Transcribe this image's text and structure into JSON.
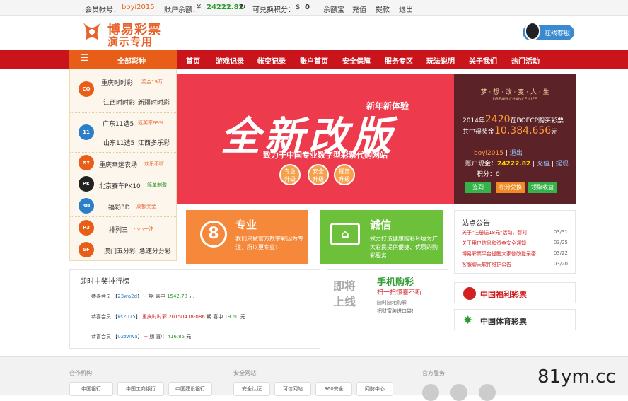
{
  "topbar": {
    "member_label": "会员帐号：",
    "member_name": "boyi2015",
    "balance_label": "账户余额：",
    "currency": "¥",
    "balance": "24222.82",
    "refresh_icon": "refresh-icon",
    "points_label": "可兑换积分：",
    "points_currency": "$",
    "points": "0",
    "links": [
      "余额宝",
      "充值",
      "提款",
      "退出"
    ]
  },
  "header": {
    "logo_line1": "博易彩票",
    "logo_line2": "演示专用",
    "online_service": "在线客服"
  },
  "nav": {
    "all_label": "全部彩种",
    "menu_icon": "menu-icon",
    "items": [
      "首页",
      "游戏记录",
      "帐变记录",
      "账户首页",
      "安全保障",
      "服务专区",
      "玩法说明",
      "关于我们",
      "热门活动"
    ]
  },
  "sidebar": {
    "rows": [
      {
        "icon": "CQ",
        "color": "#e85d17",
        "name1": "重庆时时彩",
        "badge": "奖金19万",
        "name2": "江西时时彩",
        "name3": "新疆时时彩"
      },
      {
        "icon": "11",
        "color": "#2b7fc8",
        "name1": "广东11选5",
        "badge": "返奖率69%",
        "name2": "山东11选5",
        "name3": "江西多乐彩"
      },
      {
        "icon": "XY",
        "color": "#e85d17",
        "name1": "重庆幸运农场",
        "badge": "欢乐不断"
      },
      {
        "icon": "PK",
        "color": "#222222",
        "name1": "北京赛车PK10",
        "badge": "简单刺激"
      },
      {
        "icon": "3D",
        "color": "#2b7fc8",
        "name1": "福彩3D",
        "badge": "高额奖金"
      },
      {
        "icon": "P3",
        "color": "#e85d17",
        "name1": "排列三",
        "badge": "小小一注"
      },
      {
        "icon": "5F",
        "color": "#e85d17",
        "name1": "澳门五分彩",
        "name3": "急速分分彩"
      }
    ]
  },
  "banner": {
    "small": "新年新体验",
    "headline": "全新改版",
    "subtitle": "致力于中国专业数字型彩票代购网站",
    "pills": [
      [
        "专业",
        "升级"
      ],
      [
        "安全",
        "升级"
      ],
      [
        "视觉",
        "升级"
      ]
    ]
  },
  "userpanel": {
    "slogan": "梦 · 想 · 改 · 变 · 人 · 生",
    "slogan_en": "DREAM CHANCE LIFE",
    "line1_pre": "2014年",
    "line1_num": "2420",
    "line1_post": "在BOECP购买彩票",
    "line2_pre": "共中得奖金",
    "line2_num": "10,384,656",
    "line2_post": "元",
    "username": "boyi2015",
    "sep": "|",
    "logout": "退出",
    "cash_label": "账户现金：",
    "cash": "24222.82",
    "recharge": "充值",
    "withdraw": "提现",
    "points_label": "积分：",
    "points": "0",
    "buttons": [
      "签到",
      "积分兑换",
      "领取收益"
    ]
  },
  "cards": [
    {
      "title": "专业",
      "desc": "我们只做官方数字彩因为专注，所以更专业！"
    },
    {
      "title": "诚信",
      "desc": "致力打造健康购彩环境为广大彩民提供便捷、优质的购彩服务"
    }
  ],
  "notice": {
    "title": "站点公告",
    "items": [
      {
        "text": "关于\"注册送18元\"活动，暂时",
        "date": "03/31"
      },
      {
        "text": "关于用户信息和资金安全通知",
        "date": "03/25"
      },
      {
        "text": "博易彩票平台提醒大家修改登录密",
        "date": "03/22"
      },
      {
        "text": "客服聊天软件维护公告",
        "date": "03/20"
      }
    ]
  },
  "winners": {
    "title": "即时中奖排行榜",
    "rows": [
      {
        "pre": "恭喜会员",
        "user": "23wa2d",
        "game": "--",
        "mid": "期 喜中",
        "amount": "1542.78",
        "unit": "元"
      },
      {
        "pre": "恭喜会员",
        "user": "ks2015",
        "game": "重庆时时彩",
        "issue": "20150418-086",
        "mid": "期 喜中",
        "amount": "19.60",
        "unit": "元"
      },
      {
        "pre": "恭喜会员",
        "user": "02zwwa",
        "game": "--",
        "mid": "期 喜中",
        "amount": "416.85",
        "unit": "元"
      }
    ]
  },
  "mobile": {
    "soon": "即将上线",
    "title": "手机购彩",
    "subtitle": "扫一扫惊喜不断",
    "desc1": "随时随地购彩",
    "desc2": "把财富装进口袋!"
  },
  "brands": [
    "中国福利彩票",
    "中国体育彩票"
  ],
  "footer": {
    "partners_label": "合作机构:",
    "partners": [
      "中国银行",
      "中国工商银行",
      "中国建设银行"
    ],
    "security_label": "安全网站:",
    "security": [
      "安全认证",
      "可信网站",
      "360安全",
      "网防中心"
    ],
    "service_label": "官方服务:"
  },
  "watermark": "81ym.cc"
}
